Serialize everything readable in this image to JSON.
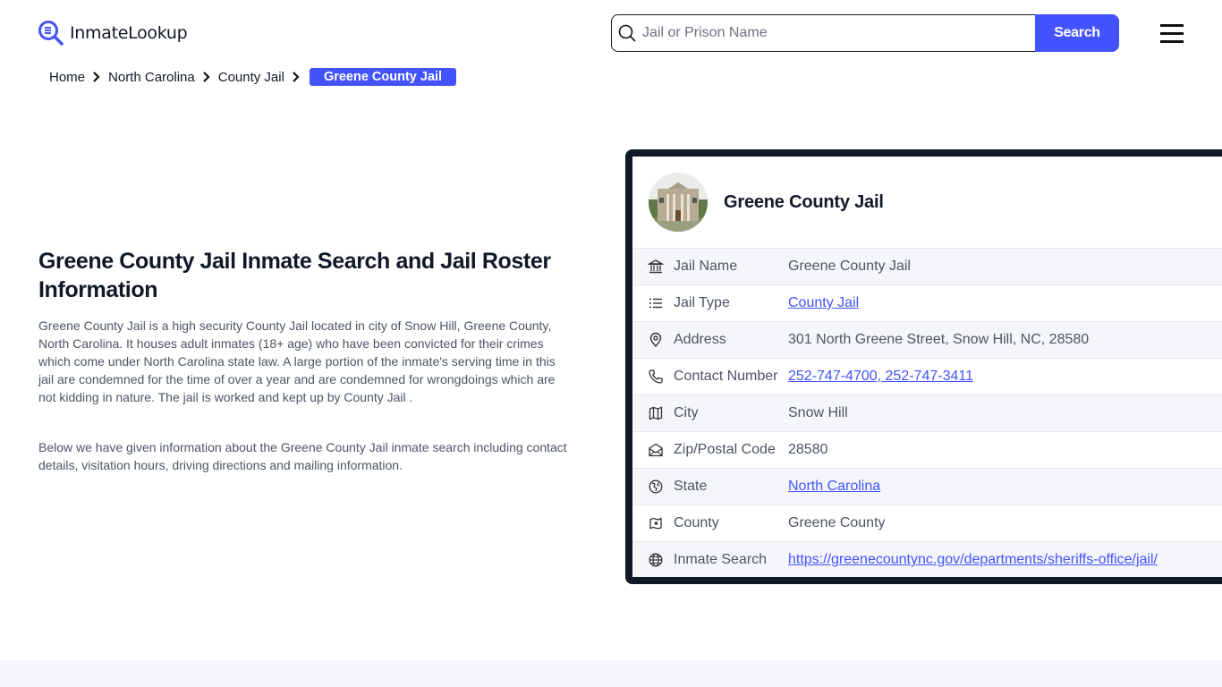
{
  "header": {
    "logo_text": "InmateLookup",
    "search_placeholder": "Jail or Prison Name",
    "search_value": "",
    "search_button": "Search",
    "menu_icon": "hamburger-menu-icon",
    "brand_color": "#4353ff"
  },
  "breadcrumb": {
    "items": [
      "Home",
      "North Carolina",
      "County Jail"
    ],
    "active": "Greene County Jail"
  },
  "main": {
    "title": "Greene County Jail Inmate Search and Jail Roster Information",
    "paragraph1": "Greene County Jail is a high security County Jail located in city of Snow Hill, Greene County, North Carolina. It houses adult inmates (18+ age) who have been convicted for their crimes which come under North Carolina state law. A large portion of the inmate's serving time in this jail are condemned for the time of over a year and are condemned for wrongdoings which are not kidding in nature. The jail is worked and kept up by County Jail .",
    "paragraph2": "Below we have given information about the Greene County Jail inmate search including contact details, visitation hours, driving directions and mailing information."
  },
  "card": {
    "title": "Greene County Jail",
    "rows": [
      {
        "icon": "bank-icon",
        "label": "Jail Name",
        "value": "Greene County Jail",
        "link": false
      },
      {
        "icon": "list-icon",
        "label": "Jail Type",
        "value": "County Jail",
        "link": true
      },
      {
        "icon": "map-pin-icon",
        "label": "Address",
        "value": "301 North Greene Street, Snow Hill, NC, 28580",
        "link": false
      },
      {
        "icon": "phone-icon",
        "label": "Contact Number",
        "value": "252-747-4700, 252-747-3411",
        "link": true
      },
      {
        "icon": "map-icon",
        "label": "City",
        "value": "Snow Hill",
        "link": false
      },
      {
        "icon": "mail-open-icon",
        "label": "Zip/Postal Code",
        "value": "28580",
        "link": false
      },
      {
        "icon": "globe-pin-icon",
        "label": "State",
        "value": "North Carolina",
        "link": true
      },
      {
        "icon": "map-marker-icon",
        "label": "County",
        "value": "Greene County",
        "link": false
      },
      {
        "icon": "globe-icon",
        "label": "Inmate Search",
        "value": "https://greenecountync.gov/departments/sheriffs-office/jail/",
        "link": true
      }
    ]
  }
}
